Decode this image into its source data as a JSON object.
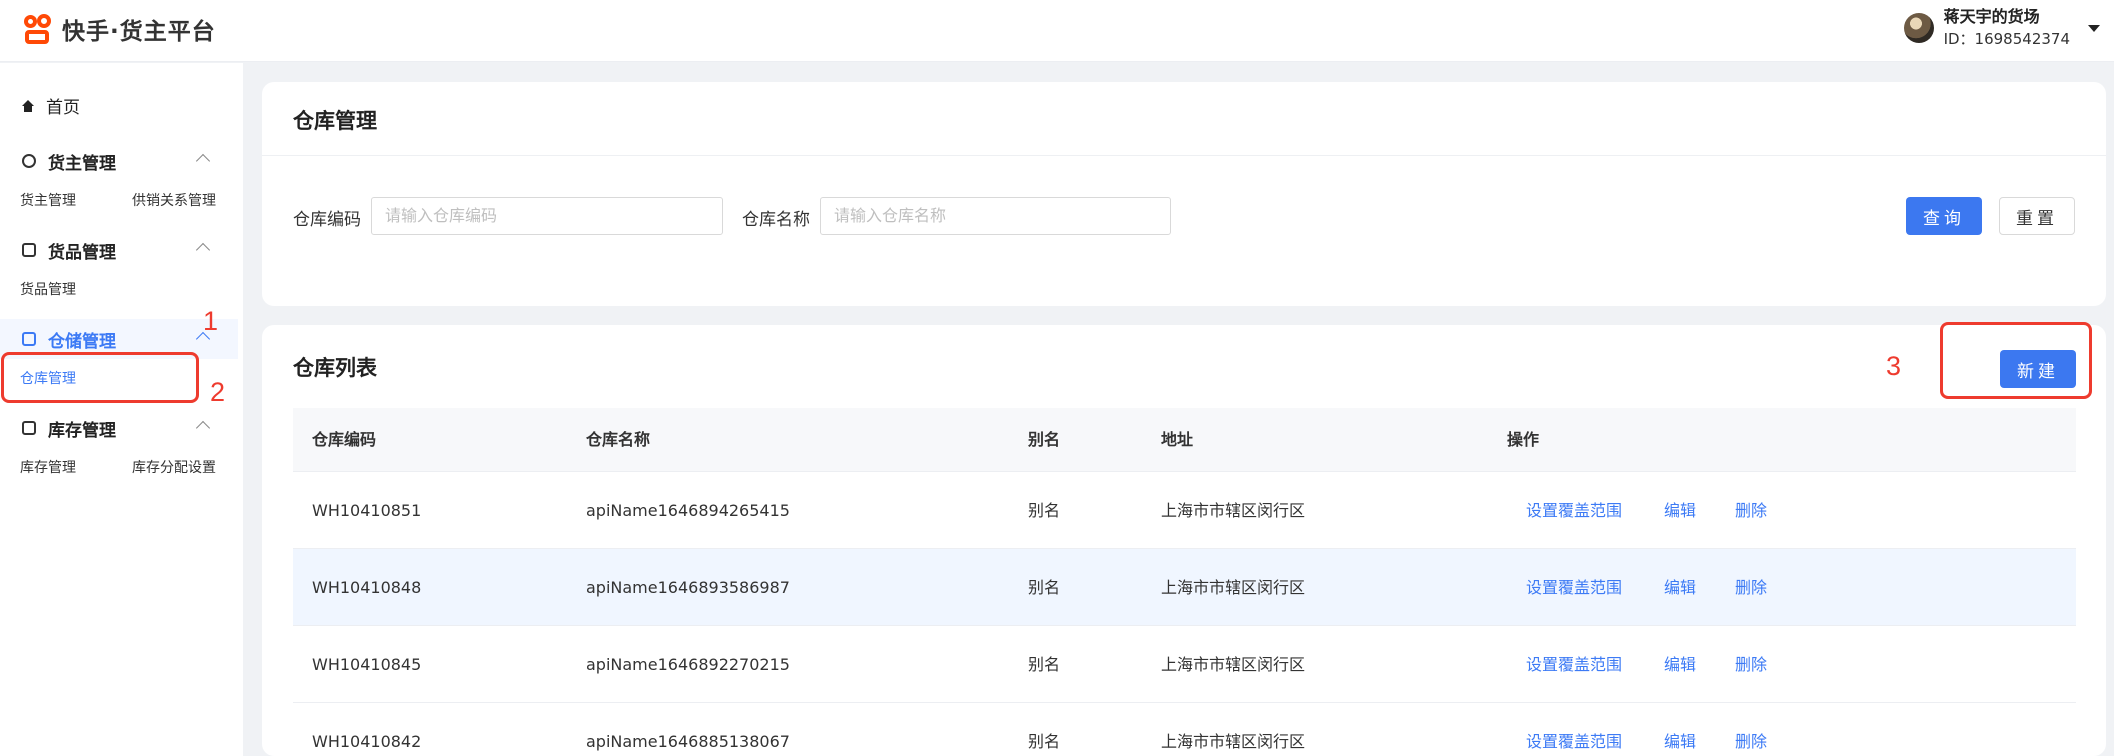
{
  "header": {
    "brand_title": "快手·货主平台",
    "user_name": "蒋天宇的货场",
    "user_id": "ID：1698542374"
  },
  "sidebar": {
    "home": "首页",
    "groups": [
      {
        "title": "货主管理",
        "items": [
          "货主管理",
          "供销关系管理"
        ]
      },
      {
        "title": "货品管理",
        "items": [
          "货品管理"
        ]
      },
      {
        "title": "仓储管理",
        "items": [
          "仓库管理"
        ]
      },
      {
        "title": "库存管理",
        "items": [
          "库存管理",
          "库存分配设置"
        ]
      }
    ]
  },
  "annotations": [
    "1",
    "2",
    "3"
  ],
  "search_card": {
    "title": "仓库管理",
    "code_label": "仓库编码",
    "code_placeholder": "请输入仓库编码",
    "name_label": "仓库名称",
    "name_placeholder": "请输入仓库名称",
    "query_button": "查询",
    "reset_button": "重置"
  },
  "list_card": {
    "title": "仓库列表",
    "new_button": "新建",
    "columns": [
      "仓库编码",
      "仓库名称",
      "别名",
      "地址",
      "操作"
    ],
    "actions": [
      "设置覆盖范围",
      "编辑",
      "删除"
    ],
    "rows": [
      {
        "code": "WH10410851",
        "name": "apiName1646894265415",
        "alias": "别名",
        "address": "上海市市辖区闵行区"
      },
      {
        "code": "WH10410848",
        "name": "apiName1646893586987",
        "alias": "别名",
        "address": "上海市市辖区闵行区"
      },
      {
        "code": "WH10410845",
        "name": "apiName1646892270215",
        "alias": "别名",
        "address": "上海市市辖区闵行区"
      },
      {
        "code": "WH10410842",
        "name": "apiName1646885138067",
        "alias": "别名",
        "address": "上海市市辖区闵行区"
      }
    ]
  }
}
